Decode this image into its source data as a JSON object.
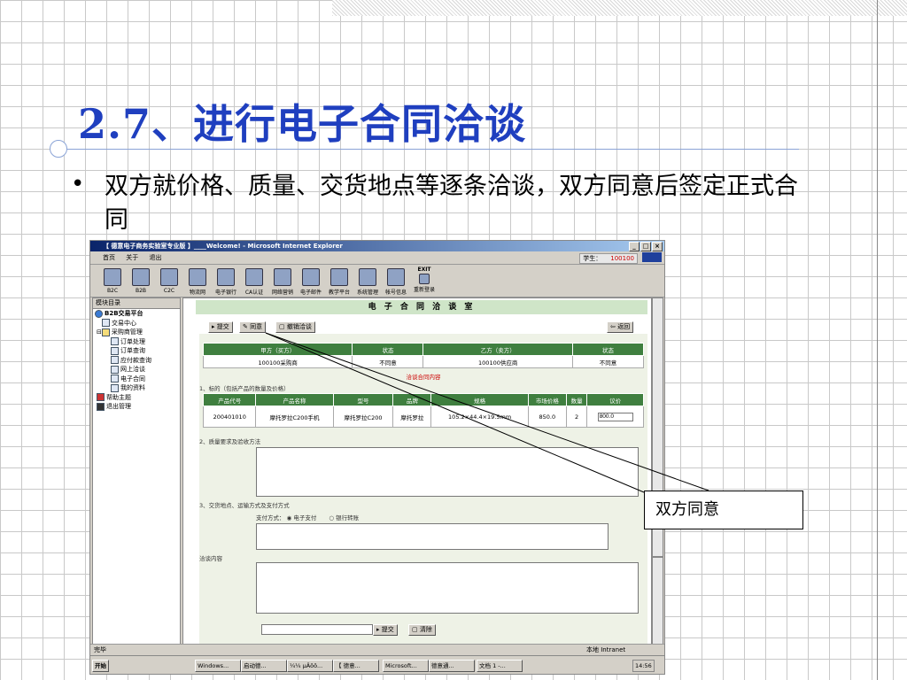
{
  "slide": {
    "title": "2.7、进行电子合同洽谈",
    "bullet": "双方就价格、质量、交货地点等逐条洽谈，双方同意后签定正式合同",
    "callout": "双方同意"
  },
  "window": {
    "title": "【 德意电子商务实验室专业版 】____Welcome! - Microsoft Internet Explorer",
    "controls": [
      "_",
      "□",
      "×"
    ],
    "menu": [
      "首页",
      "关于",
      "退出"
    ],
    "student_label": "学生：",
    "student_id": "100100",
    "toolbar": [
      "B2C",
      "B2B",
      "C2C",
      "物流网",
      "电子银行",
      "CA认证",
      "网络营销",
      "电子邮件",
      "教学平台",
      "系统管理",
      "帐号信息",
      "重新登录"
    ],
    "exit_label": "EXIT"
  },
  "sidebar": {
    "title": "模块目录",
    "items": [
      "B2B交易平台",
      "交易中心",
      "采购商管理",
      "订单处理",
      "订单查询",
      "应付款查询",
      "网上洽谈",
      "电子合同",
      "我的资料",
      "帮助主题",
      "退出管理"
    ]
  },
  "room": {
    "title": "电 子 合 同 洽 谈 室",
    "submit": "提交",
    "agree": "同意",
    "cancel": "撤销洽谈",
    "back": "返回"
  },
  "parties": {
    "headers": [
      "甲方（买方）",
      "状态",
      "乙方（卖方）",
      "状态"
    ],
    "row": [
      "100100采购商",
      "不同意",
      "100100供应商",
      "不同意"
    ]
  },
  "contract": {
    "title": "洽谈合同内容",
    "section1": "1、标的（包括产品的数量及价格）",
    "product_headers": [
      "产品代号",
      "产品名称",
      "型号",
      "品牌",
      "规格",
      "市场价格",
      "数量",
      "议价"
    ],
    "product_row": [
      "200401010",
      "摩托罗拉C200手机",
      "摩托罗拉C200",
      "摩托罗拉",
      "105.2×44.4×19.5mm",
      "850.0",
      "2",
      "800.0"
    ],
    "section2": "2、质量要求及验收方法",
    "section3": "3、交货地点、运输方式及支付方式",
    "pay_label": "支付方式：",
    "pay_options": [
      "电子支付",
      "银行转账"
    ],
    "talk_title": "洽谈内容",
    "talk_submit": "提交",
    "talk_clear": "清除"
  },
  "status": {
    "text": "完毕",
    "zone": "本地 Intranet"
  },
  "taskbar": {
    "start": "开始",
    "tasks": [
      "Windows...",
      "启动德...",
      "¼¼ µÄôô...",
      "【 德意...",
      "Microsoft...",
      "德意通...",
      "文档 1 -..."
    ],
    "clock": "14:56"
  }
}
